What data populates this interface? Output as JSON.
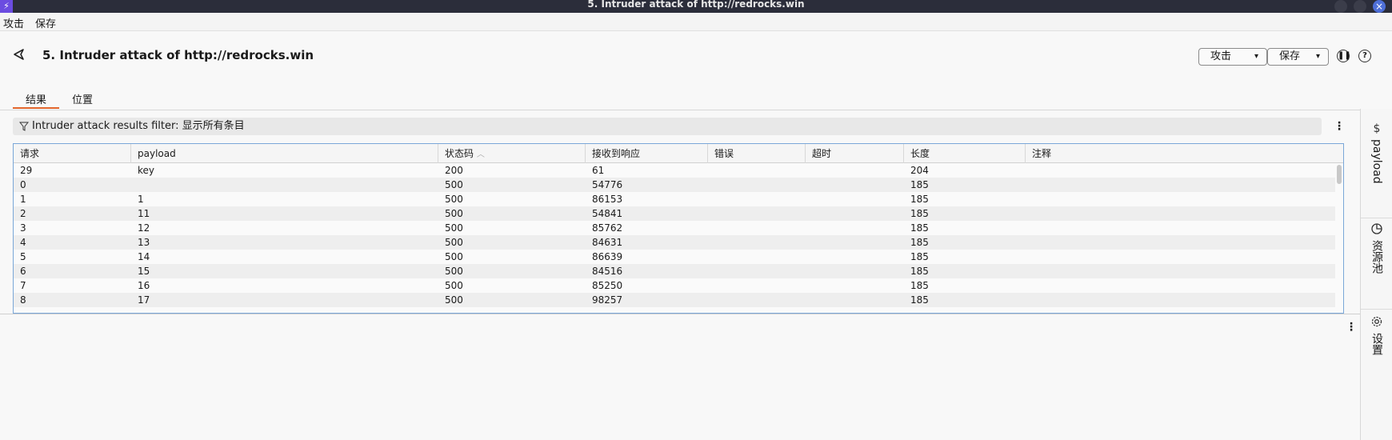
{
  "window": {
    "title": "5. Intruder attack of http://redrocks.win"
  },
  "menu": {
    "attack": "攻击",
    "save": "保存"
  },
  "header": {
    "title": "5. Intruder attack of http://redrocks.win",
    "attack_button": "攻击",
    "save_button": "保存"
  },
  "tabs": [
    {
      "label": "结果",
      "active": true
    },
    {
      "label": "位置",
      "active": false
    }
  ],
  "filter": {
    "text": "Intruder attack results filter: 显示所有条目"
  },
  "table": {
    "columns": [
      "请求",
      "payload",
      "状态码",
      "接收到响应",
      "错误",
      "超时",
      "长度",
      "注释"
    ],
    "sort_column": "状态码",
    "sort_direction": "ascending",
    "rows": [
      [
        "29",
        "key",
        "200",
        "61",
        "",
        "",
        "204",
        ""
      ],
      [
        "0",
        "",
        "500",
        "54776",
        "",
        "",
        "185",
        ""
      ],
      [
        "1",
        "1",
        "500",
        "86153",
        "",
        "",
        "185",
        ""
      ],
      [
        "2",
        "11",
        "500",
        "54841",
        "",
        "",
        "185",
        ""
      ],
      [
        "3",
        "12",
        "500",
        "85762",
        "",
        "",
        "185",
        ""
      ],
      [
        "4",
        "13",
        "500",
        "84631",
        "",
        "",
        "185",
        ""
      ],
      [
        "5",
        "14",
        "500",
        "86639",
        "",
        "",
        "185",
        ""
      ],
      [
        "6",
        "15",
        "500",
        "84516",
        "",
        "",
        "185",
        ""
      ],
      [
        "7",
        "16",
        "500",
        "85250",
        "",
        "",
        "185",
        ""
      ],
      [
        "8",
        "17",
        "500",
        "98257",
        "",
        "",
        "185",
        ""
      ]
    ]
  },
  "sidebar": {
    "items": [
      {
        "label": "payload",
        "icon": "dollar-icon"
      },
      {
        "label": "资源池",
        "icon": "pie-chart-icon"
      },
      {
        "label": "设置",
        "icon": "gear-icon"
      }
    ]
  },
  "colors": {
    "accent": "#e2652b",
    "table_border": "#7aa7d8",
    "titlebar": "#2b2d3a"
  }
}
